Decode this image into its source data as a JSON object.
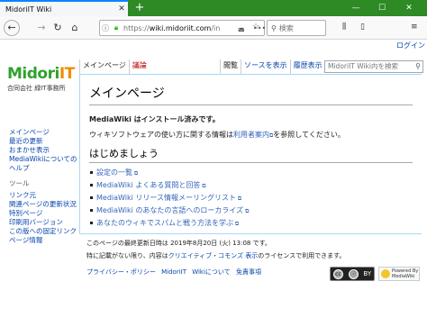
{
  "browser": {
    "tab_title": "MidoriIT Wiki",
    "new_tab": "+",
    "url_prefix": "https://",
    "url_host": "wiki.midoriit.com",
    "url_rest": "/in",
    "url_dots": "•••",
    "search_placeholder": "検索"
  },
  "header": {
    "login": "ログイン"
  },
  "logo": {
    "name_green": "Midori",
    "name_orange": "IT",
    "subtitle": "合同会社 緑IT事務所"
  },
  "page_tabs": {
    "left": [
      {
        "label": "メインページ",
        "selected": true
      },
      {
        "label": "議論",
        "selected": false,
        "missing": true
      }
    ],
    "right": [
      {
        "label": "閲覧",
        "selected": true
      },
      {
        "label": "ソースを表示",
        "selected": false
      },
      {
        "label": "履歴表示",
        "selected": false
      }
    ],
    "search_placeholder": "MidoriIT Wiki内を検索"
  },
  "content": {
    "title": "メインページ",
    "installed": "MediaWiki はインストール済みです。",
    "usage_pre": "ウィキソフトウェアの使い方に関する情報は",
    "usage_link": "利用者案内",
    "usage_post": "を参照してください。",
    "section_title": "はじめましょう",
    "links": [
      "設定の一覧",
      "MediaWiki よくある質問と回答",
      "MediaWiki リリース情報メーリングリスト",
      "MediaWiki のあなたの言語へのローカライズ",
      "あなたのウィキでスパムと戦う方法を学ぶ"
    ]
  },
  "sidebar": {
    "nav": [
      "メインページ",
      "最近の更新",
      "おまかせ表示",
      "MediaWikiについてのヘルプ"
    ],
    "tools_heading": "ツール",
    "tools": [
      "リンク元",
      "関連ページの更新状況",
      "特別ページ",
      "印刷用バージョン",
      "この版への固定リンク",
      "ページ情報"
    ]
  },
  "footer": {
    "last_modified": "このページの最終更新日時は 2019年8月20日 (火) 13:08 です。",
    "license_pre": "特に記載がない限り、内容は",
    "license_link": "クリエイティブ・コモンズ 表示",
    "license_post": "のライセンスで利用できます。",
    "links": [
      "プライバシー・ポリシー",
      "MidoriIT Wikiについて",
      "免責事項"
    ],
    "cc_badge": "BY",
    "mw_badge_top": "Powered By",
    "mw_badge_bottom": "MediaWiki"
  }
}
